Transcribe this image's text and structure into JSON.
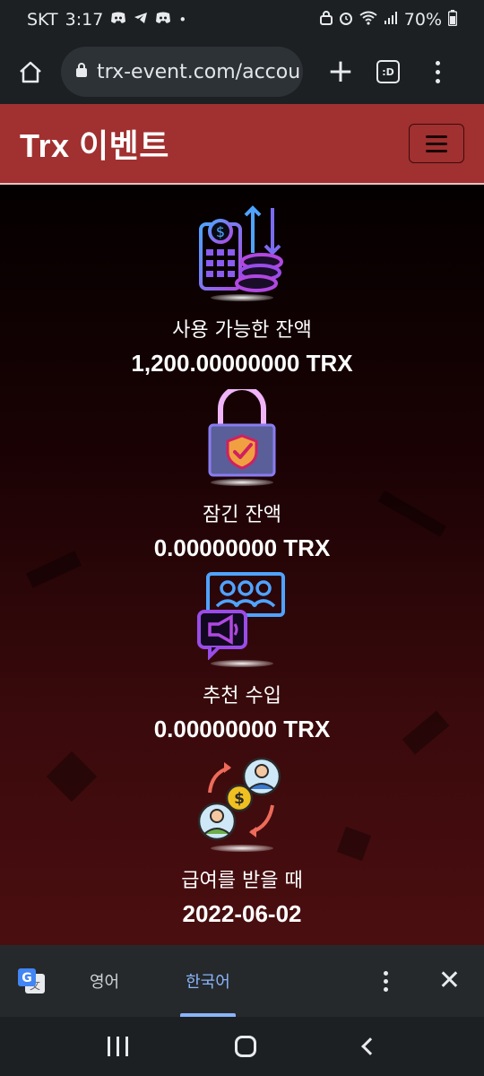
{
  "status_bar": {
    "carrier": "SKT",
    "time": "3:17",
    "battery": "70%",
    "icons": [
      "discord-icon",
      "telegram-icon",
      "discord-icon",
      "dot-icon",
      "lock-icon",
      "alarm-icon",
      "wifi-icon",
      "signal-icon",
      "battery-icon"
    ]
  },
  "browser": {
    "url": "trx-event.com/accou",
    "tab_count": ":D",
    "icons": [
      "home-icon",
      "lock-icon",
      "plus-icon",
      "tabs-icon",
      "more-vert-icon"
    ]
  },
  "site": {
    "brand": "Trx 이벤트",
    "accent": "#a13030"
  },
  "cards": [
    {
      "label": "사용 가능한 잔액",
      "value": "1,200.00000000 TRX",
      "icon": "calculator-coins-icon"
    },
    {
      "label": "잠긴 잔액",
      "value": "0.00000000 TRX",
      "icon": "padlock-shield-icon"
    },
    {
      "label": "추천 수입",
      "value": "0.00000000 TRX",
      "icon": "referral-megaphone-icon"
    },
    {
      "label": "급여를 받을 때",
      "value": "2022-06-02",
      "icon": "payment-exchange-icon"
    }
  ],
  "translate_bar": {
    "source_lang": "영어",
    "target_lang": "한국어",
    "accent": "#8ab4f8"
  }
}
